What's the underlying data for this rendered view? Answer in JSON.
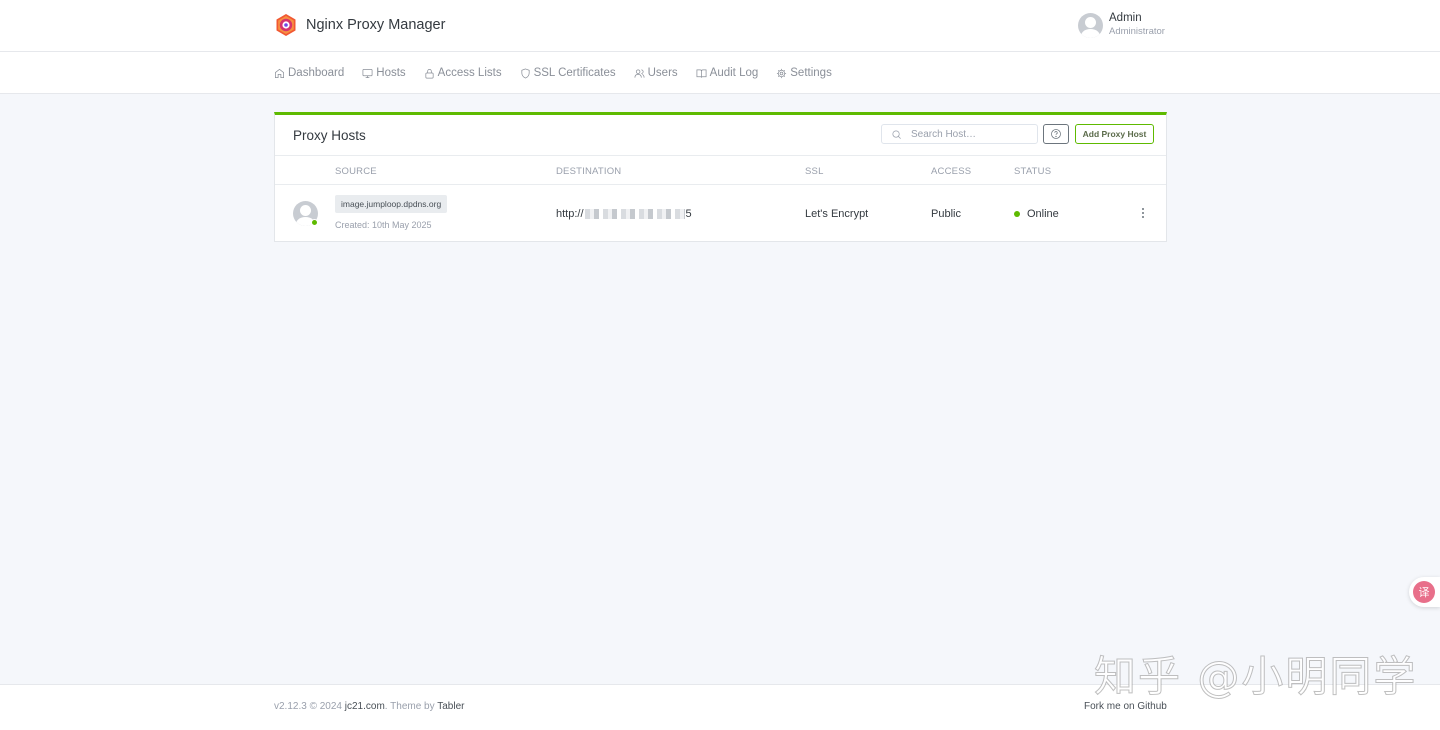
{
  "app": {
    "title": "Nginx Proxy Manager"
  },
  "user": {
    "name": "Admin",
    "role": "Administrator"
  },
  "nav": {
    "items": [
      {
        "label": "Dashboard",
        "icon": "home-icon"
      },
      {
        "label": "Hosts",
        "icon": "monitor-icon"
      },
      {
        "label": "Access Lists",
        "icon": "lock-icon"
      },
      {
        "label": "SSL Certificates",
        "icon": "shield-icon"
      },
      {
        "label": "Users",
        "icon": "users-icon"
      },
      {
        "label": "Audit Log",
        "icon": "book-icon"
      },
      {
        "label": "Settings",
        "icon": "gear-icon"
      }
    ]
  },
  "card": {
    "title": "Proxy Hosts",
    "search_placeholder": "Search Host…",
    "add_label": "Add Proxy Host",
    "accent_color": "#5eba00"
  },
  "table": {
    "headers": {
      "source": "SOURCE",
      "destination": "DESTINATION",
      "ssl": "SSL",
      "access": "ACCESS",
      "status": "STATUS"
    },
    "rows": [
      {
        "domain": "image.jumploop.dpdns.org",
        "created": "Created: 10th May 2025",
        "destination_prefix": "http://",
        "destination_suffix": "5",
        "ssl": "Let's Encrypt",
        "access": "Public",
        "status": "Online"
      }
    ]
  },
  "footer": {
    "version": "v2.12.3 © 2024 ",
    "site": "jc21.com",
    "theme_text": ". Theme by ",
    "theme_name": "Tabler",
    "fork": "Fork me on Github"
  },
  "watermark": "知乎 @小明同学",
  "float_tool_label": "译"
}
